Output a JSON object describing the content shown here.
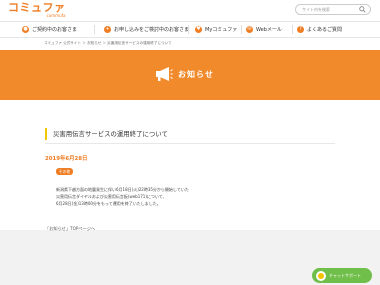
{
  "header": {
    "logo_main": "コミュファ",
    "logo_sub": "commufa",
    "search_placeholder": "サイト内を検索"
  },
  "nav": {
    "items": [
      {
        "label": "ご契約中のお客さま",
        "icon": "person-icon"
      },
      {
        "label": "お申し込みをご検討中のお客さま",
        "icon": "person-plus-icon"
      },
      {
        "label": "Myコミュファ",
        "icon": "heart-icon"
      },
      {
        "label": "Webメール",
        "icon": "mail-icon"
      },
      {
        "label": "よくあるご質問",
        "icon": "question-icon"
      }
    ]
  },
  "breadcrumb": "コミュファ 公式サイト ＞ お知らせ ＞ 災害用伝言サービスの運用終了について",
  "banner": {
    "title": "お知らせ",
    "icon": "megaphone-icon"
  },
  "article": {
    "title": "災害用伝言サービスの運用終了について",
    "date": "2019年6月28日",
    "category": "その他",
    "body": [
      "新潟県下越方面の地震発生に伴い6月18日(火)22時35分から開始していた",
      "災害用伝言ダイヤルおよび災害用伝言板(web171)について、",
      "6月28日(金)13時00分をもって運用を終了いたしました。"
    ]
  },
  "back_link": "「お知らせ」TOPページへ",
  "chat": {
    "label": "チャットサポート"
  },
  "colors": {
    "brand_orange": "#f08a2b",
    "accent_yellow": "#f0c800",
    "chat_green": "#6fbf4a"
  }
}
